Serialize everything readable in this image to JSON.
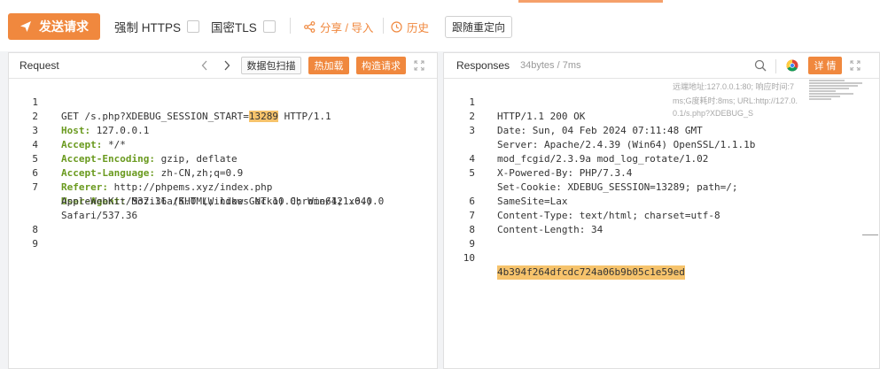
{
  "toolbar": {
    "send_label": "发送请求",
    "force_https_label": "强制 HTTPS",
    "gm_tls_label": "国密TLS",
    "share_label": "分享 / 导入",
    "history_label": "历史",
    "redirect_label": "跟随重定向"
  },
  "request": {
    "title": "Request",
    "packet_scan_label": "数据包扫描",
    "hot_load_label": "热加载",
    "construct_label": "构造请求",
    "lines": [
      {
        "num": "1",
        "prefix": "GET /s.php?XDEBUG_SESSION_START=",
        "highlight": "13289",
        "suffix": " HTTP/1.1"
      },
      {
        "num": "2",
        "key": "Host:",
        "value": " 127.0.0.1"
      },
      {
        "num": "3",
        "key": "Accept:",
        "value": " */*"
      },
      {
        "num": "4",
        "key": "Accept-Encoding:",
        "value": " gzip, deflate"
      },
      {
        "num": "5",
        "key": "Accept-Language:",
        "value": " zh-CN,zh;q=0.9"
      },
      {
        "num": "6",
        "key": "Referer:",
        "value": " http://phpems.xyz/index.php"
      },
      {
        "num": "7",
        "key": "User-Agent:",
        "value": " Mozilla/5.0 (Windows NT 10.0; Win64; x64)"
      },
      {
        "num": "8"
      },
      {
        "num": "9"
      }
    ],
    "wrap_ua_1": "AppleWebKit/537.36 (KHTML, like Gecko) Chrome/121.0.0.0",
    "wrap_ua_2": "Safari/537.36"
  },
  "response": {
    "title": "Responses",
    "meta": "34bytes / 7ms",
    "detail_label": "详 情",
    "ghost_text_1": "远端地址:127.0.0.1:80; 响应时间:7",
    "ghost_text_2": "ms;G度耗时:8ms; URL:http://127.0.",
    "ghost_text_3": "0.1/s.php?XDEBUG_S",
    "lines": [
      {
        "num": "1",
        "text": "HTTP/1.1 200 OK"
      },
      {
        "num": "2",
        "text": "Date: Sun, 04 Feb 2024 07:11:48 GMT"
      },
      {
        "num": "3",
        "text": "Server: Apache/2.4.39 (Win64) OpenSSL/1.1.1b"
      },
      {
        "num": "",
        "text": "mod_fcgid/2.3.9a mod_log_rotate/1.02"
      },
      {
        "num": "4",
        "text": "X-Powered-By: PHP/7.3.4"
      },
      {
        "num": "5",
        "text": "Set-Cookie: XDEBUG_SESSION=13289; path=/;"
      },
      {
        "num": "",
        "text": "SameSite=Lax"
      },
      {
        "num": "6",
        "text": "Content-Type: text/html; charset=utf-8"
      },
      {
        "num": "7",
        "text": "Content-Length: 34"
      },
      {
        "num": "8",
        "text": ""
      },
      {
        "num": "9",
        "text": ""
      },
      {
        "num": "10",
        "text": "4b394f264dfcdc724a06b9b05c1e59ed"
      }
    ]
  },
  "colors": {
    "accent": "#f0883e",
    "header_key": "#6a9a1f",
    "highlight": "#f6c36c"
  },
  "icons": [
    "send-icon",
    "share-icon",
    "history-icon",
    "chevron-left-icon",
    "chevron-right-icon",
    "expand-icon",
    "search-icon",
    "chrome-icon"
  ]
}
